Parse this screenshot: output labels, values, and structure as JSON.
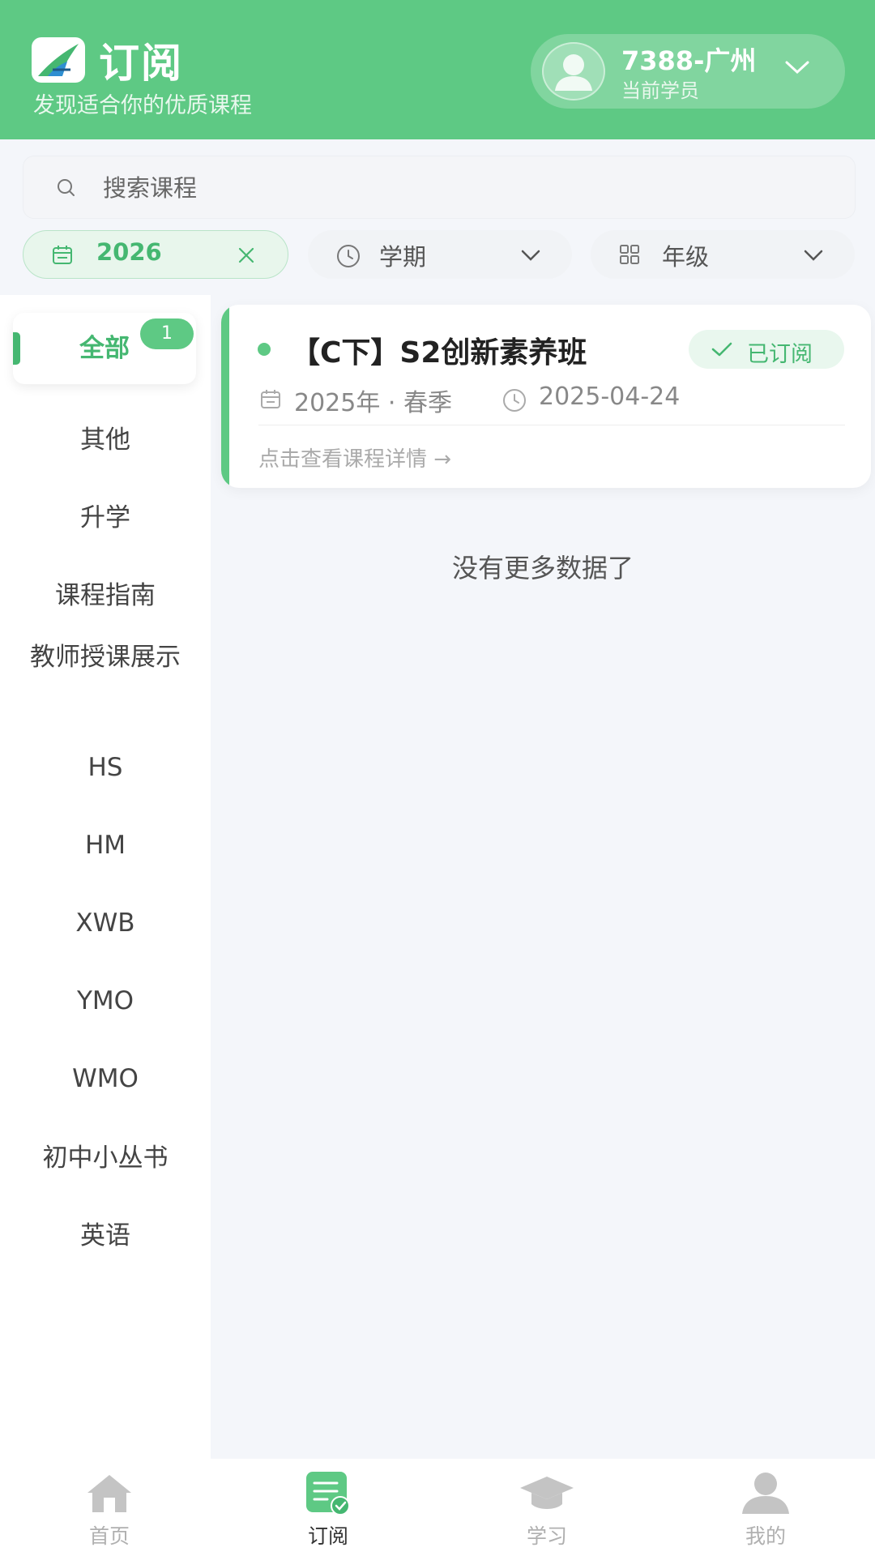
{
  "header": {
    "title": "订阅",
    "subtitle": "发现适合你的优质课程",
    "user": {
      "name": "7388-广州",
      "role": "当前学员"
    }
  },
  "search": {
    "placeholder": "搜索课程"
  },
  "filters": {
    "year": "2026",
    "term": "学期",
    "grade": "年级"
  },
  "sidebar": {
    "items": [
      {
        "label": "全部",
        "badge": "1",
        "active": true
      },
      {
        "label": "其他"
      },
      {
        "label": "升学"
      },
      {
        "label": "课程指南"
      },
      {
        "label": "教师授课展示"
      },
      {
        "label": "HS"
      },
      {
        "label": "HM"
      },
      {
        "label": "XWB"
      },
      {
        "label": "YMO"
      },
      {
        "label": "WMO"
      },
      {
        "label": "初中小丛书"
      },
      {
        "label": "英语"
      }
    ]
  },
  "course": {
    "title": "【C下】S2创新素养班",
    "status": "已订阅",
    "period": "2025年 · 春季",
    "date": "2025-04-24",
    "link": "点击查看课程详情 →"
  },
  "list_end_text": "没有更多数据了",
  "tabbar": {
    "items": [
      {
        "label": "首页",
        "icon": "home-icon"
      },
      {
        "label": "订阅",
        "icon": "subscribe-icon",
        "active": true
      },
      {
        "label": "学习",
        "icon": "graduation-cap-icon"
      },
      {
        "label": "我的",
        "icon": "person-icon"
      }
    ]
  },
  "colors": {
    "brand_green": "#5ec984",
    "accent_green": "#45b771",
    "inactive_gray": "#b0b0b0"
  }
}
